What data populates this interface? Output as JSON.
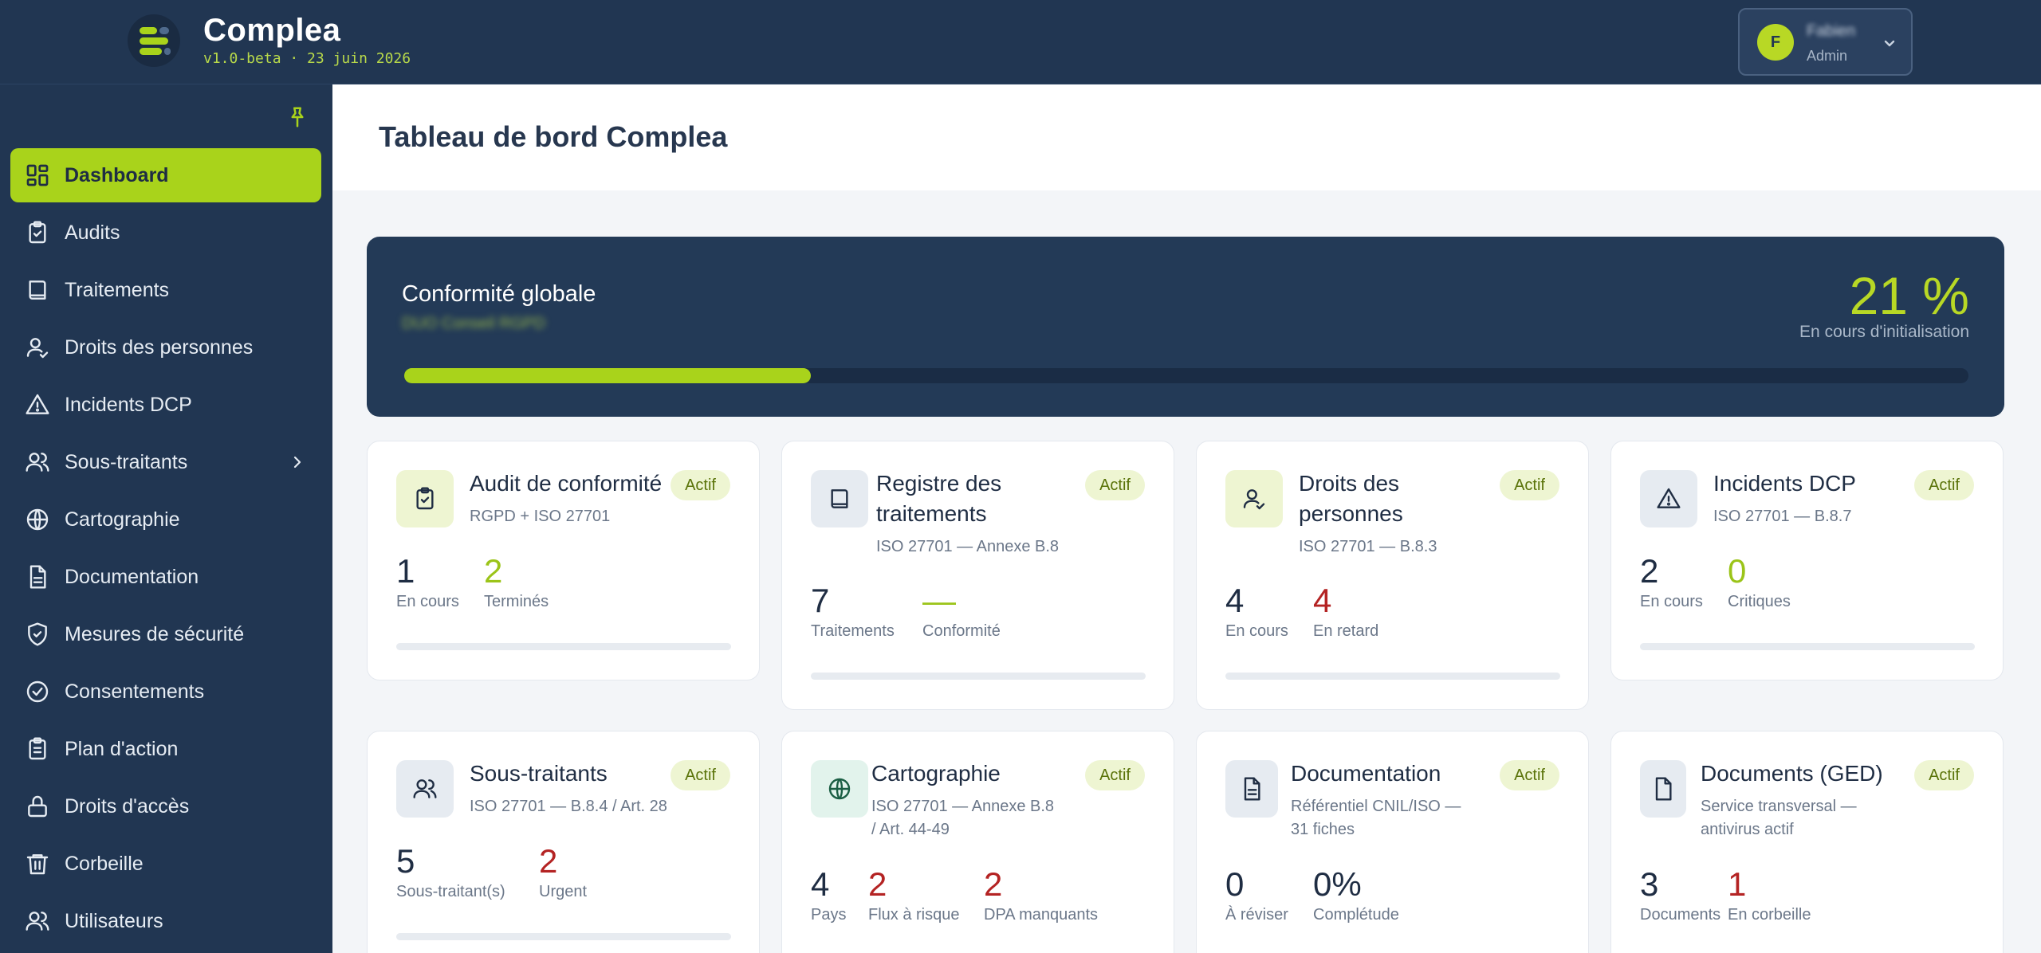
{
  "app": {
    "name": "Complea",
    "version": "v1.0-beta · 23 juin 2026"
  },
  "user": {
    "initial": "F",
    "name": "Fabien",
    "role": "Admin"
  },
  "sidebar": {
    "items": [
      {
        "label": "Dashboard",
        "icon": "dashboard-icon",
        "active": true
      },
      {
        "label": "Audits",
        "icon": "clipboard-check-icon"
      },
      {
        "label": "Traitements",
        "icon": "book-icon"
      },
      {
        "label": "Droits des personnes",
        "icon": "user-check-icon"
      },
      {
        "label": "Incidents DCP",
        "icon": "warning-triangle-icon"
      },
      {
        "label": "Sous-traitants",
        "icon": "users-icon",
        "has_children": true
      },
      {
        "label": "Cartographie",
        "icon": "globe-icon"
      },
      {
        "label": "Documentation",
        "icon": "file-text-icon"
      },
      {
        "label": "Mesures de sécurité",
        "icon": "shield-check-icon"
      },
      {
        "label": "Consentements",
        "icon": "check-circle-icon"
      },
      {
        "label": "Plan d'action",
        "icon": "clipboard-list-icon"
      },
      {
        "label": "Droits d'accès",
        "icon": "lock-icon"
      },
      {
        "label": "Corbeille",
        "icon": "trash-icon"
      },
      {
        "label": "Utilisateurs",
        "icon": "users-icon"
      }
    ]
  },
  "page": {
    "title": "Tableau de bord Complea"
  },
  "compliance": {
    "title": "Conformité globale",
    "subtitle": "DUO Conseil RGPD",
    "percent_label": "21 %",
    "progress": 0.26,
    "status": "En cours d'initialisation"
  },
  "cards": [
    {
      "title": "Audit de conformité",
      "subtitle": "RGPD + ISO 27701",
      "badge": "Actif",
      "icon": "clipboard-check-icon",
      "stats": [
        {
          "value": "1",
          "label": "En cours",
          "color": "#1f2d43"
        },
        {
          "value": "2",
          "label": "Terminés",
          "color": "#9bc419"
        }
      ]
    },
    {
      "title": "Registre des traitements",
      "subtitle": "ISO 27701 — Annexe B.8",
      "badge": "Actif",
      "icon": "book-icon",
      "stats": [
        {
          "value": "7",
          "label": "Traitements",
          "color": "#1f2d43"
        },
        {
          "value": "—",
          "label": "Conformité",
          "color": "#9bc419"
        }
      ]
    },
    {
      "title": "Droits des personnes",
      "subtitle": "ISO 27701 — B.8.3",
      "badge": "Actif",
      "icon": "user-check-icon",
      "stats": [
        {
          "value": "4",
          "label": "En cours",
          "color": "#1f2d43"
        },
        {
          "value": "4",
          "label": "En retard",
          "color": "#b42323"
        }
      ]
    },
    {
      "title": "Incidents DCP",
      "subtitle": "ISO 27701 — B.8.7",
      "badge": "Actif",
      "icon": "warning-triangle-icon",
      "stats": [
        {
          "value": "2",
          "label": "En cours",
          "color": "#1f2d43"
        },
        {
          "value": "0",
          "label": "Critiques",
          "color": "#9bc419"
        }
      ]
    },
    {
      "title": "Sous-traitants",
      "subtitle": "ISO 27701 — B.8.4 / Art. 28",
      "badge": "Actif",
      "icon": "users-icon",
      "stats": [
        {
          "value": "5",
          "label": "Sous-traitant(s)",
          "color": "#1f2d43"
        },
        {
          "value": "2",
          "label": "Urgent",
          "color": "#b42323"
        }
      ]
    },
    {
      "title": "Cartographie",
      "subtitle": "ISO 27701 — Annexe B.8 / Art. 44-49",
      "badge": "Actif",
      "icon": "globe-icon",
      "stats": [
        {
          "value": "4",
          "label": "Pays",
          "color": "#1f2d43"
        },
        {
          "value": "2",
          "label": "Flux à risque",
          "color": "#b42323"
        },
        {
          "value": "2",
          "label": "DPA manquants",
          "color": "#b42323"
        }
      ]
    },
    {
      "title": "Documentation",
      "subtitle": "Référentiel CNIL/ISO — 31 fiches",
      "badge": "Actif",
      "icon": "file-text-icon",
      "stats": [
        {
          "value": "0",
          "label": "À réviser",
          "color": "#1f2d43"
        },
        {
          "value": "0%",
          "label": "Complétude",
          "color": "#1f2d43"
        }
      ]
    },
    {
      "title": "Documents (GED)",
      "subtitle": "Service transversal — antivirus actif",
      "badge": "Actif",
      "icon": "file-icon",
      "stats": [
        {
          "value": "3",
          "label": "Documents",
          "color": "#1f2d43"
        },
        {
          "value": "1",
          "label": "En corbeille",
          "color": "#b42323"
        }
      ]
    }
  ],
  "colors": {
    "sidebar_bg": "#213652",
    "accent": "#a9d31b",
    "danger": "#b42323"
  }
}
